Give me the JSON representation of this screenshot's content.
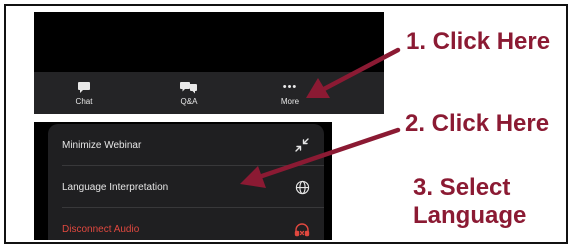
{
  "toolbar": {
    "items": [
      {
        "label": "Chat",
        "icon": "chat-icon"
      },
      {
        "label": "Q&A",
        "icon": "qa-icon"
      },
      {
        "label": "More",
        "icon": "more-icon"
      }
    ]
  },
  "menu": {
    "items": [
      {
        "label": "Minimize Webinar",
        "icon": "minimize-icon"
      },
      {
        "label": "Language Interpretation",
        "icon": "globe-icon"
      },
      {
        "label": "Disconnect Audio",
        "icon": "disconnect-audio-icon"
      }
    ]
  },
  "annotations": {
    "step1": "1. Click Here",
    "step2": "2. Click Here",
    "step3_line1": "3. Select",
    "step3_line2": "Language"
  },
  "colors": {
    "annotation": "#8b1a33",
    "danger": "#e0483f",
    "toolbar_bg": "#242426",
    "menu_bg": "#1f1f21"
  }
}
